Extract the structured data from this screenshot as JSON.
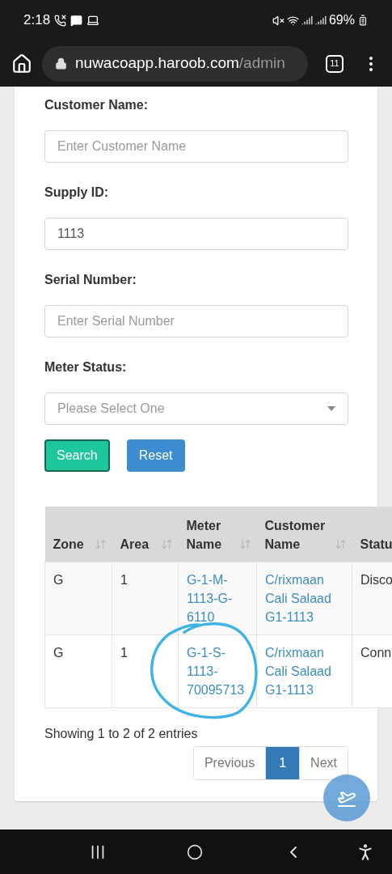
{
  "status_bar": {
    "time": "2:18",
    "battery": "69%"
  },
  "browser": {
    "url_host": "nuwacoapp.haroob.com",
    "url_path": "/admin",
    "tab_count": "11"
  },
  "form": {
    "fields": [
      {
        "label": "Customer Name:",
        "kind": "text",
        "placeholder": "Enter Customer Name"
      },
      {
        "label": "Supply ID:",
        "kind": "text",
        "value": "1113"
      },
      {
        "label": "Serial Number:",
        "kind": "text",
        "placeholder": "Enter Serial Number"
      },
      {
        "label": "Meter Status:",
        "kind": "select",
        "placeholder": "Please Select One"
      }
    ],
    "buttons": [
      {
        "label": "Search",
        "kind": "success"
      },
      {
        "label": "Reset",
        "kind": "primary"
      }
    ]
  },
  "table": {
    "columns": [
      {
        "label": "Zone",
        "kind": "text",
        "sortable": true
      },
      {
        "label": "Area",
        "kind": "text",
        "sortable": true
      },
      {
        "label": "Meter Name",
        "kind": "link",
        "sortable": true
      },
      {
        "label": "Customer Name",
        "kind": "link",
        "sortable": true
      },
      {
        "label": "Statu",
        "kind": "text",
        "sortable": false
      }
    ],
    "rows": [
      [
        "G",
        "1",
        "G-1-M-1113-G-6110",
        "C/rixmaan Cali Salaad G1-1113",
        "Disco"
      ],
      [
        "G",
        "1",
        "G-1-S-1113-70095713",
        "C/rixmaan Cali Salaad G1-1113",
        "Conn"
      ]
    ]
  },
  "info": "Showing 1 to 2 of 2 entries",
  "pagination": [
    {
      "label": "Previous",
      "kind": "nav",
      "selected": false
    },
    {
      "label": "1",
      "kind": "page",
      "selected": true
    },
    {
      "label": "Next",
      "kind": "nav",
      "selected": false
    }
  ]
}
